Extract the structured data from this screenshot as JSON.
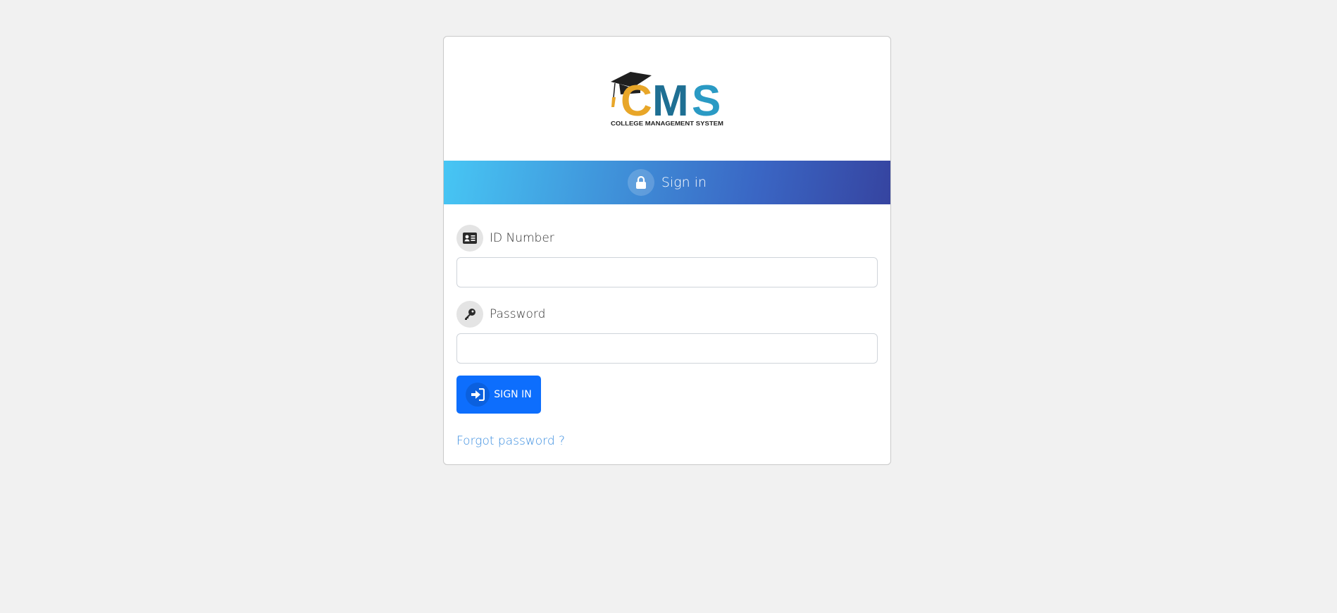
{
  "logo": {
    "letters": "CMS",
    "tagline": "COLLEGE MANAGEMENT SYSTEM",
    "colors": {
      "c": "#e8a628",
      "m": "#1e6f93",
      "s": "#2a9ac4",
      "cap": "#1f1f1f",
      "tassel": "#e8a628"
    }
  },
  "header": {
    "title": "Sign in",
    "icon": "lock-icon",
    "gradient": [
      "#47c6f4",
      "#3644a0"
    ]
  },
  "form": {
    "id_field": {
      "label": "ID Number",
      "icon": "id-card-icon",
      "value": "",
      "placeholder": ""
    },
    "password_field": {
      "label": "Password",
      "icon": "key-icon",
      "value": "",
      "placeholder": ""
    },
    "submit": {
      "label": "SIGN IN",
      "icon": "sign-in-icon",
      "color": "#0d6efd"
    },
    "forgot_link": "Forgot password ?"
  }
}
